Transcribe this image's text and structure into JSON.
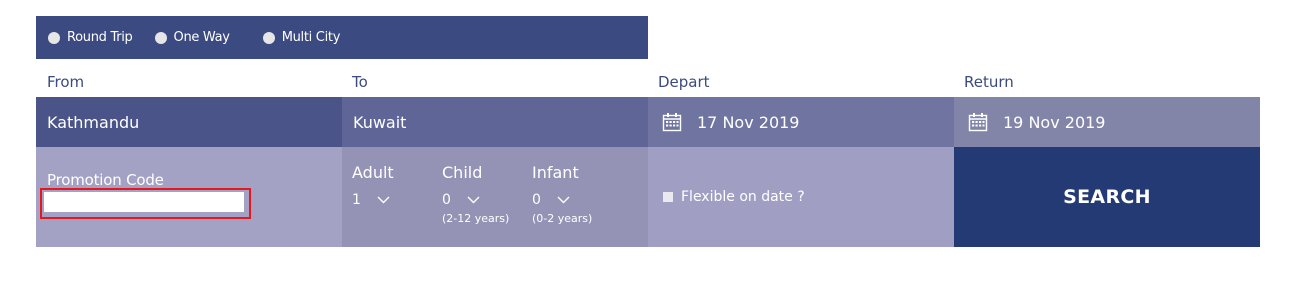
{
  "trip_types": {
    "round_trip": "Round Trip",
    "one_way": "One Way",
    "multi_city": "Multi City"
  },
  "labels": {
    "from": "From",
    "to": "To",
    "depart": "Depart",
    "return": "Return"
  },
  "fields": {
    "from_value": "Kathmandu",
    "to_value": "Kuwait",
    "depart_date": "17 Nov 2019",
    "return_date": "19 Nov 2019"
  },
  "promo": {
    "label": "Promotion Code",
    "value": ""
  },
  "passengers": {
    "adult": {
      "label": "Adult",
      "value": "1"
    },
    "child": {
      "label": "Child",
      "value": "0",
      "note": "(2-12 years)"
    },
    "infant": {
      "label": "Infant",
      "value": "0",
      "note": "(0-2 years)"
    }
  },
  "flexible_label": "Flexible on date ?",
  "search_label": "SEARCH",
  "colors": {
    "brand": "#3b4a80",
    "search": "#233a74",
    "highlight": "#e8161d"
  }
}
